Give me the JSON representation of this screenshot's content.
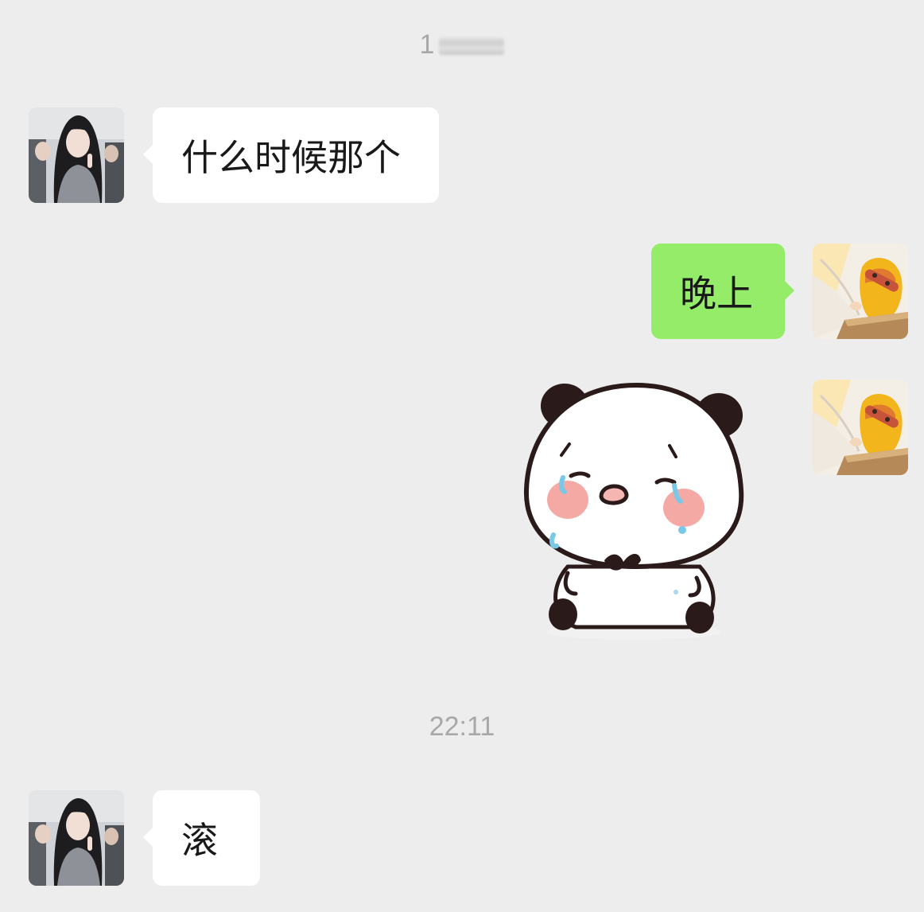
{
  "chat": {
    "timestamp_top_visible": "1",
    "timestamp_bottom": "22:11",
    "messages": [
      {
        "direction": "incoming",
        "type": "text",
        "text": "什么时候那个",
        "avatar": "contact-avatar"
      },
      {
        "direction": "outgoing",
        "type": "text",
        "text": "晚上",
        "avatar": "self-avatar"
      },
      {
        "direction": "outgoing",
        "type": "sticker",
        "sticker": "crying-panda-sticker",
        "avatar": "self-avatar"
      },
      {
        "direction": "incoming",
        "type": "text",
        "text": "滚",
        "avatar": "contact-avatar"
      }
    ]
  },
  "colors": {
    "background": "#ededed",
    "incoming_bubble": "#ffffff",
    "outgoing_bubble": "#95ec69",
    "timestamp_text": "#a8a8a8",
    "message_text": "#191919"
  }
}
